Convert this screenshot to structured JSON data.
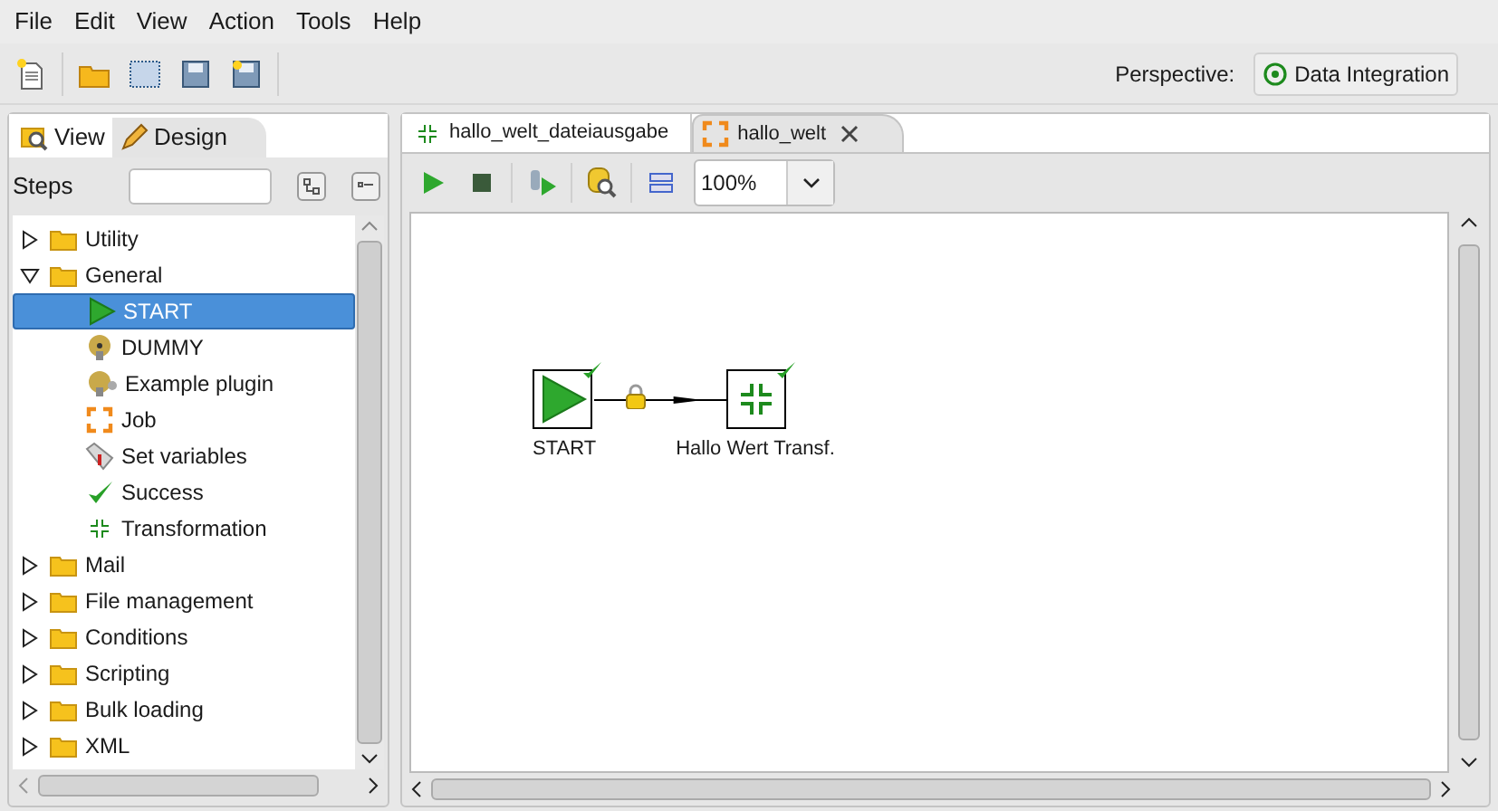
{
  "menu": [
    "File",
    "Edit",
    "View",
    "Action",
    "Tools",
    "Help"
  ],
  "perspective": {
    "label": "Perspective:",
    "value": "Data Integration"
  },
  "left_tabs": [
    {
      "label": "View",
      "kind": "view",
      "selected": false
    },
    {
      "label": "Design",
      "kind": "design",
      "selected": true
    }
  ],
  "steps": {
    "label": "Steps"
  },
  "tree": [
    {
      "label": "Utility",
      "expanded": false,
      "selected": false
    },
    {
      "label": "General",
      "expanded": true,
      "selected": false,
      "children": [
        {
          "label": "START",
          "kind": "start",
          "selected": true
        },
        {
          "label": "DUMMY",
          "kind": "dummy",
          "selected": false
        },
        {
          "label": "Example plugin",
          "kind": "plugin",
          "selected": false
        },
        {
          "label": "Job",
          "kind": "job",
          "selected": false
        },
        {
          "label": "Set variables",
          "kind": "variables",
          "selected": false
        },
        {
          "label": "Success",
          "kind": "success",
          "selected": false
        },
        {
          "label": "Transformation",
          "kind": "transformation",
          "selected": false
        }
      ]
    },
    {
      "label": "Mail",
      "expanded": false,
      "selected": false
    },
    {
      "label": "File management",
      "expanded": false,
      "selected": false
    },
    {
      "label": "Conditions",
      "expanded": false,
      "selected": false
    },
    {
      "label": "Scripting",
      "expanded": false,
      "selected": false
    },
    {
      "label": "Bulk loading",
      "expanded": false,
      "selected": false
    },
    {
      "label": "XML",
      "expanded": false,
      "selected": false
    }
  ],
  "doc_tabs": [
    {
      "label": "hallo_welt_dateiausgabe",
      "kind": "transformation",
      "selected": false,
      "closable": false
    },
    {
      "label": "hallo_welt",
      "kind": "job",
      "selected": true,
      "closable": true
    }
  ],
  "zoom": {
    "value": "100%"
  },
  "canvas": {
    "nodes": [
      {
        "label": "START",
        "kind": "start"
      },
      {
        "label": "Hallo Wert Transf.",
        "kind": "transformation"
      }
    ]
  }
}
